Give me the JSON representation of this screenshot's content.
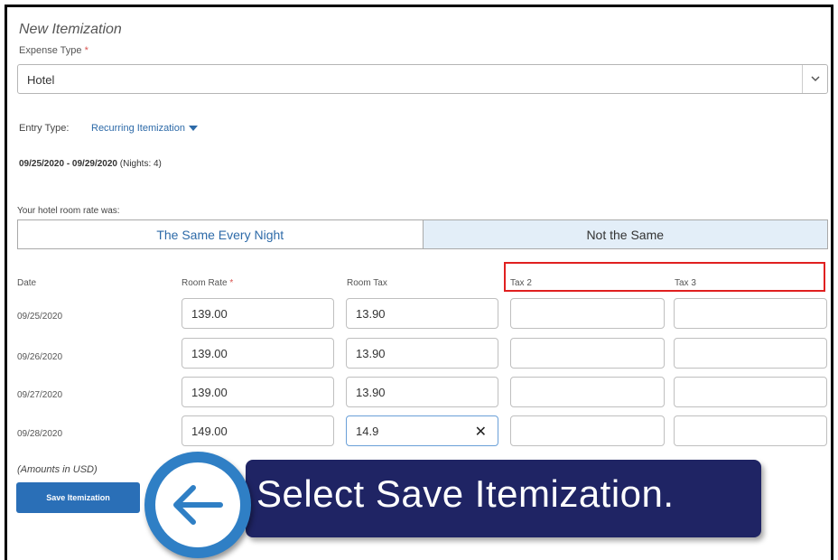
{
  "form": {
    "title": "New Itemization",
    "expense_type_label": "Expense Type",
    "required_mark": "*",
    "expense_type_value": "Hotel",
    "entry_type_label": "Entry Type:",
    "entry_type_value": "Recurring Itemization",
    "date_range": "09/25/2020 - 09/29/2020",
    "nights": "(Nights: 4)",
    "rate_question": "Your hotel room rate was:",
    "segment": {
      "same_label": "The Same Every Night",
      "not_same_label": "Not the Same",
      "selected": "Not the Same"
    },
    "columns": {
      "date": "Date",
      "room_rate": "Room Rate",
      "room_tax": "Room Tax",
      "tax2": "Tax 2",
      "tax3": "Tax 3"
    },
    "rows": [
      {
        "date": "09/25/2020",
        "room_rate": "139.00",
        "room_tax": "13.90",
        "tax2": "",
        "tax3": ""
      },
      {
        "date": "09/26/2020",
        "room_rate": "139.00",
        "room_tax": "13.90",
        "tax2": "",
        "tax3": ""
      },
      {
        "date": "09/27/2020",
        "room_rate": "139.00",
        "room_tax": "13.90",
        "tax2": "",
        "tax3": ""
      },
      {
        "date": "09/28/2020",
        "room_rate": "149.00",
        "room_tax": "14.9",
        "tax2": "",
        "tax3": ""
      }
    ],
    "amounts_note": "(Amounts in USD)",
    "save_label": "Save Itemization"
  },
  "callout": {
    "text": "Select Save Itemization."
  },
  "colors": {
    "accent": "#2a6fb7",
    "highlight": "#e02020",
    "callout_bg": "#1f2464"
  },
  "icons": [
    "chevron-down-icon",
    "caret-down-icon",
    "clear-icon",
    "arrow-left-icon"
  ]
}
